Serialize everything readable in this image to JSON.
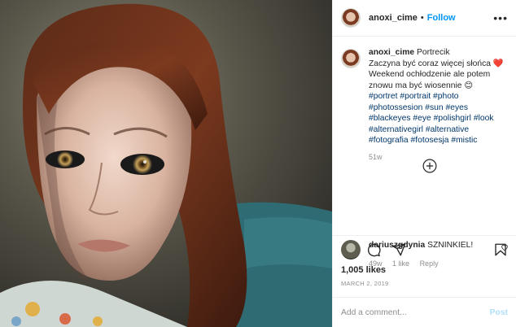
{
  "post": {
    "username": "anoxi_cime",
    "follow_label": "Follow",
    "separator": "•",
    "more_label": "•••",
    "caption": {
      "title": "Portrecik",
      "line1": "Zaczyna być coraz więcej słońca",
      "line2": "Weekend ochłodzenie ale potem znowu ma być wiosennie",
      "emoji": "😊",
      "heart": "❤️",
      "hashtags": [
        "#portret",
        "#portrait",
        "#photo",
        "#photossesion",
        "#sun",
        "#eyes",
        "#blackeyes",
        "#eye",
        "#polishgirl",
        "#look",
        "#alternativegirl",
        "#alternative",
        "#fotografia",
        "#fotosesja",
        "#mistic"
      ],
      "age": "51w"
    },
    "comment": {
      "username": "dariuszgdynia",
      "text": "SZNINKIEL!",
      "age": "49w",
      "likes": "1 like",
      "reply_label": "Reply"
    },
    "likes_text": "1,005 likes",
    "date": "MARCH 2, 2019",
    "add_comment_placeholder": "Add a comment...",
    "post_button_label": "Post"
  },
  "colors": {
    "accent": "#0095f6",
    "hashtag": "#00376b",
    "muted": "#8e8e8e",
    "heart": "#e0245e"
  },
  "icons": [
    "heart-icon",
    "comment-icon",
    "share-icon",
    "bookmark-icon",
    "add-circle-icon",
    "small-heart-icon"
  ]
}
